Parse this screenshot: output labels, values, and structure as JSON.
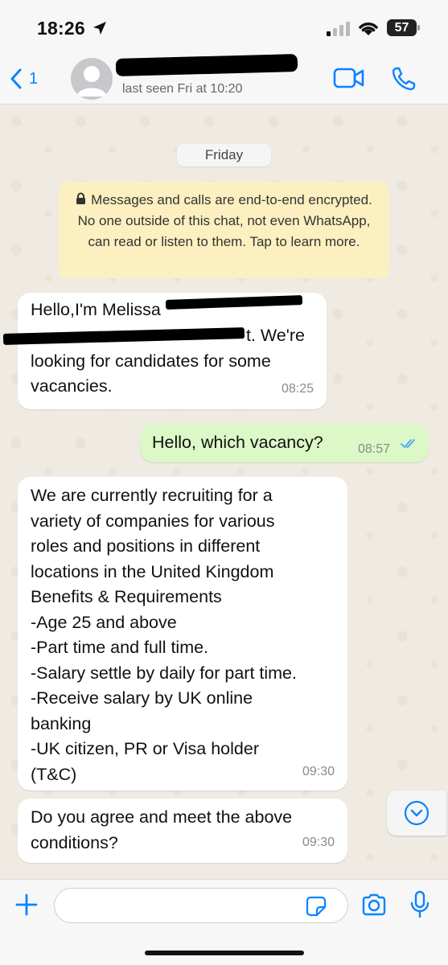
{
  "status_bar": {
    "time": "18:26",
    "battery": "57"
  },
  "header": {
    "back_count": "1",
    "last_seen": "last seen Fri at 10:20"
  },
  "chat": {
    "date_label": "Friday",
    "encryption_notice": "Messages and calls are end-to-end encrypted. No one outside of this chat, not even WhatsApp, can read or listen to them. Tap to learn more.",
    "messages": [
      {
        "direction": "incoming",
        "line1": "Hello,I'm Melissa",
        "line2": "t. We're",
        "line3": "looking for candidates for some",
        "line4": "vacancies.",
        "time": "08:25"
      },
      {
        "direction": "outgoing",
        "text": "Hello, which vacancy?",
        "time": "08:57"
      },
      {
        "direction": "incoming",
        "text": "We are currently recruiting for a\nvariety of companies for various\nroles and positions in different\nlocations in the United Kingdom\nBenefits & Requirements\n-Age 25 and above\n-Part time and full time.\n-Salary settle by daily for part time.\n-Receive salary by UK online\nbanking\n-UK citizen, PR or Visa holder\n(T&C)",
        "time": "09:30"
      },
      {
        "direction": "incoming",
        "text": "Do you agree and meet the above\nconditions?",
        "time": "09:30"
      }
    ]
  },
  "colors": {
    "ios_blue": "#0a84ff",
    "outgoing_bubble": "#dbf8c6",
    "notice_bg": "#fcf0c0"
  }
}
